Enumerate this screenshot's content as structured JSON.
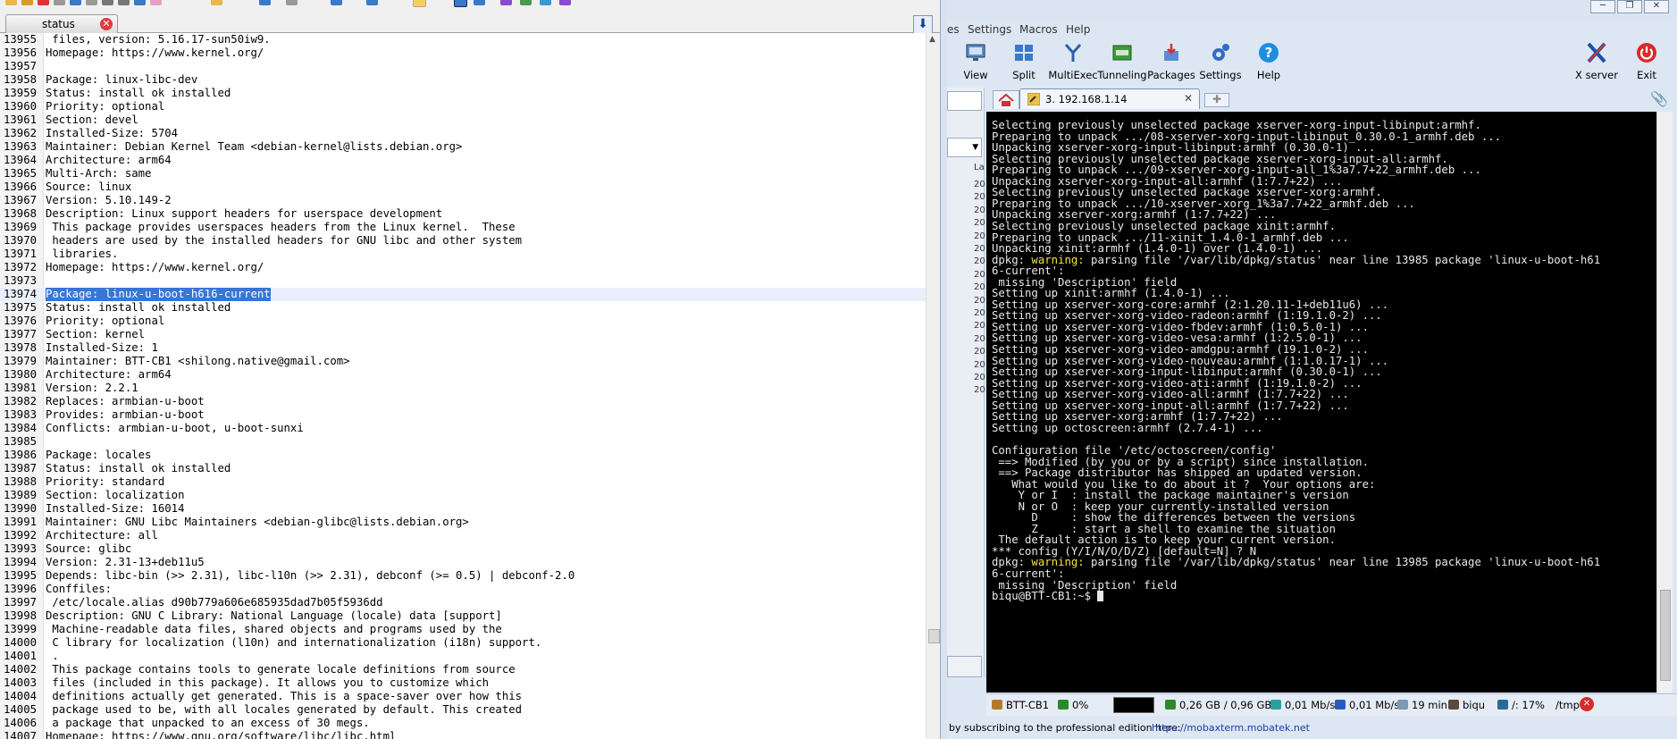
{
  "editor": {
    "tab_label": "status",
    "lines": [
      {
        "num": "13955",
        "text": " files, version: 5.16.17-sun50iw9."
      },
      {
        "num": "13956",
        "text": "Homepage: https://www.kernel.org/"
      },
      {
        "num": "13957",
        "text": ""
      },
      {
        "num": "13958",
        "text": "Package: linux-libc-dev"
      },
      {
        "num": "13959",
        "text": "Status: install ok installed"
      },
      {
        "num": "13960",
        "text": "Priority: optional"
      },
      {
        "num": "13961",
        "text": "Section: devel"
      },
      {
        "num": "13962",
        "text": "Installed-Size: 5704"
      },
      {
        "num": "13963",
        "text": "Maintainer: Debian Kernel Team <debian-kernel@lists.debian.org>"
      },
      {
        "num": "13964",
        "text": "Architecture: arm64"
      },
      {
        "num": "13965",
        "text": "Multi-Arch: same"
      },
      {
        "num": "13966",
        "text": "Source: linux"
      },
      {
        "num": "13967",
        "text": "Version: 5.10.149-2"
      },
      {
        "num": "13968",
        "text": "Description: Linux support headers for userspace development"
      },
      {
        "num": "13969",
        "text": " This package provides userspaces headers from the Linux kernel.  These"
      },
      {
        "num": "13970",
        "text": " headers are used by the installed headers for GNU libc and other system"
      },
      {
        "num": "13971",
        "text": " libraries."
      },
      {
        "num": "13972",
        "text": "Homepage: https://www.kernel.org/"
      },
      {
        "num": "13973",
        "text": ""
      },
      {
        "num": "13974",
        "text": "Package: linux-u-boot-h616-current",
        "highlight": true
      },
      {
        "num": "13975",
        "text": "Status: install ok installed"
      },
      {
        "num": "13976",
        "text": "Priority: optional"
      },
      {
        "num": "13977",
        "text": "Section: kernel"
      },
      {
        "num": "13978",
        "text": "Installed-Size: 1"
      },
      {
        "num": "13979",
        "text": "Maintainer: BTT-CB1 <shilong.native@gmail.com>"
      },
      {
        "num": "13980",
        "text": "Architecture: arm64"
      },
      {
        "num": "13981",
        "text": "Version: 2.2.1"
      },
      {
        "num": "13982",
        "text": "Replaces: armbian-u-boot"
      },
      {
        "num": "13983",
        "text": "Provides: armbian-u-boot"
      },
      {
        "num": "13984",
        "text": "Conflicts: armbian-u-boot, u-boot-sunxi"
      },
      {
        "num": "13985",
        "text": ""
      },
      {
        "num": "13986",
        "text": "Package: locales"
      },
      {
        "num": "13987",
        "text": "Status: install ok installed"
      },
      {
        "num": "13988",
        "text": "Priority: standard"
      },
      {
        "num": "13989",
        "text": "Section: localization"
      },
      {
        "num": "13990",
        "text": "Installed-Size: 16014"
      },
      {
        "num": "13991",
        "text": "Maintainer: GNU Libc Maintainers <debian-glibc@lists.debian.org>"
      },
      {
        "num": "13992",
        "text": "Architecture: all"
      },
      {
        "num": "13993",
        "text": "Source: glibc"
      },
      {
        "num": "13994",
        "text": "Version: 2.31-13+deb11u5"
      },
      {
        "num": "13995",
        "text": "Depends: libc-bin (>> 2.31), libc-l10n (>> 2.31), debconf (>= 0.5) | debconf-2.0"
      },
      {
        "num": "13996",
        "text": "Conffiles:"
      },
      {
        "num": "13997",
        "text": " /etc/locale.alias d90b779a606e685935dad7b05f5936dd"
      },
      {
        "num": "13998",
        "text": "Description: GNU C Library: National Language (locale) data [support]"
      },
      {
        "num": "13999",
        "text": " Machine-readable data files, shared objects and programs used by the"
      },
      {
        "num": "14000",
        "text": " C library for localization (l10n) and internationalization (i18n) support."
      },
      {
        "num": "14001",
        "text": " ."
      },
      {
        "num": "14002",
        "text": " This package contains tools to generate locale definitions from source"
      },
      {
        "num": "14003",
        "text": " files (included in this package). It allows you to customize which"
      },
      {
        "num": "14004",
        "text": " definitions actually get generated. This is a space-saver over how this"
      },
      {
        "num": "14005",
        "text": " package used to be, with all locales generated by default. This created"
      },
      {
        "num": "14006",
        "text": " a package that unpacked to an excess of 30 megs."
      },
      {
        "num": "14007",
        "text": "Homepage: https://www.gnu.org/software/libc/libc.html"
      }
    ]
  },
  "moba": {
    "menu": [
      "es",
      "Settings",
      "Macros",
      "Help"
    ],
    "tools": [
      {
        "label": "View",
        "icon": "view-icon"
      },
      {
        "label": "Split",
        "icon": "split-icon"
      },
      {
        "label": "MultiExec",
        "icon": "multiexec-icon"
      },
      {
        "label": "Tunneling",
        "icon": "tunneling-icon"
      },
      {
        "label": "Packages",
        "icon": "packages-icon"
      },
      {
        "label": "Settings",
        "icon": "settings-icon"
      },
      {
        "label": "Help",
        "icon": "help-icon"
      }
    ],
    "xserver_label": "X server",
    "exit_label": "Exit",
    "sidebar_header": "La",
    "sidebar_rows": [
      "20",
      "20",
      "20",
      "20",
      "20",
      "20",
      "20",
      "20",
      "20",
      "20",
      "20",
      "20",
      "20",
      "20",
      "20",
      "20",
      "20"
    ],
    "session_tab": "3. 192.168.1.14",
    "terminal_lines": [
      {
        "t": "Selecting previously unselected package xserver-xorg-input-libinput:armhf."
      },
      {
        "t": "Preparing to unpack .../08-xserver-xorg-input-libinput_0.30.0-1_armhf.deb ..."
      },
      {
        "t": "Unpacking xserver-xorg-input-libinput:armhf (0.30.0-1) ..."
      },
      {
        "t": "Selecting previously unselected package xserver-xorg-input-all:armhf."
      },
      {
        "t": "Preparing to unpack .../09-xserver-xorg-input-all_1%3a7.7+22_armhf.deb ..."
      },
      {
        "t": "Unpacking xserver-xorg-input-all:armhf (1:7.7+22) ..."
      },
      {
        "t": "Selecting previously unselected package xserver-xorg:armhf."
      },
      {
        "t": "Preparing to unpack .../10-xserver-xorg_1%3a7.7+22_armhf.deb ..."
      },
      {
        "t": "Unpacking xserver-xorg:armhf (1:7.7+22) ..."
      },
      {
        "t": "Selecting previously unselected package xinit:armhf."
      },
      {
        "t": "Preparing to unpack .../11-xinit_1.4.0-1_armhf.deb ..."
      },
      {
        "t": "Unpacking xinit:armhf (1.4.0-1) over (1.4.0-1) ..."
      },
      {
        "pre": "dpkg: ",
        "warn": "warning:",
        "t": " parsing file '/var/lib/dpkg/status' near line 13985 package 'linux-u-boot-h61"
      },
      {
        "t": "6-current':"
      },
      {
        "t": " missing 'Description' field"
      },
      {
        "t": "Setting up xinit:armhf (1.4.0-1) ..."
      },
      {
        "t": "Setting up xserver-xorg-core:armhf (2:1.20.11-1+deb11u6) ..."
      },
      {
        "t": "Setting up xserver-xorg-video-radeon:armhf (1:19.1.0-2) ..."
      },
      {
        "t": "Setting up xserver-xorg-video-fbdev:armhf (1:0.5.0-1) ..."
      },
      {
        "t": "Setting up xserver-xorg-video-vesa:armhf (1:2.5.0-1) ..."
      },
      {
        "t": "Setting up xserver-xorg-video-amdgpu:armhf (19.1.0-2) ..."
      },
      {
        "t": "Setting up xserver-xorg-video-nouveau:armhf (1:1.0.17-1) ..."
      },
      {
        "t": "Setting up xserver-xorg-input-libinput:armhf (0.30.0-1) ..."
      },
      {
        "t": "Setting up xserver-xorg-video-ati:armhf (1:19.1.0-2) ..."
      },
      {
        "t": "Setting up xserver-xorg-video-all:armhf (1:7.7+22) ..."
      },
      {
        "t": "Setting up xserver-xorg-input-all:armhf (1:7.7+22) ..."
      },
      {
        "t": "Setting up xserver-xorg:armhf (1:7.7+22) ..."
      },
      {
        "t": "Setting up octoscreen:armhf (2.7.4-1) ..."
      },
      {
        "t": ""
      },
      {
        "t": "Configuration file '/etc/octoscreen/config'"
      },
      {
        "t": " ==> Modified (by you or by a script) since installation."
      },
      {
        "t": " ==> Package distributor has shipped an updated version."
      },
      {
        "t": "   What would you like to do about it ?  Your options are:"
      },
      {
        "t": "    Y or I  : install the package maintainer's version"
      },
      {
        "t": "    N or O  : keep your currently-installed version"
      },
      {
        "t": "      D     : show the differences between the versions"
      },
      {
        "t": "      Z     : start a shell to examine the situation"
      },
      {
        "t": " The default action is to keep your current version."
      },
      {
        "t": "*** config (Y/I/N/O/D/Z) [default=N] ? N"
      },
      {
        "pre": "dpkg: ",
        "warn": "warning:",
        "t": " parsing file '/var/lib/dpkg/status' near line 13985 package 'linux-u-boot-h61"
      },
      {
        "t": "6-current':"
      },
      {
        "t": " missing 'Description' field"
      },
      {
        "t": "biqu@BTT-CB1:~$ ",
        "cursor": true
      }
    ],
    "status": {
      "host": "BTT-CB1",
      "cpu": "0%",
      "memory": "0,26 GB / 0,96 GB",
      "upload": "0,01 Mb/s",
      "download": "0,01 Mb/s",
      "uptime": "19 min",
      "user": "biqu",
      "disk": "/: 17%",
      "tmp": "/tmp"
    },
    "footer_text": "by subscribing to the professional edition here:",
    "footer_link": "https://mobaxterm.mobatek.net"
  }
}
